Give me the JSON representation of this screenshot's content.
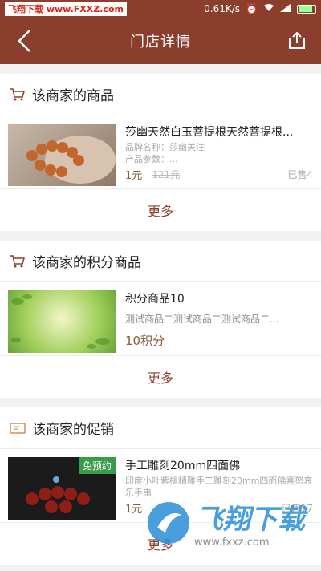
{
  "status": {
    "watermark": "飞翔下载 www.FXXZ.com",
    "speed": "0.61K/s"
  },
  "header": {
    "title": "门店详情"
  },
  "sections": {
    "goods": {
      "title": "该商家的商品",
      "item": {
        "name": "莎幽天然白玉菩提根天然菩提根...",
        "brand": "品牌名称：莎幽关注",
        "params": "产品参数：...",
        "price": "1元",
        "old_price": "121元",
        "sold": "已售4"
      },
      "more": "更多"
    },
    "points": {
      "title": "该商家的积分商品",
      "item": {
        "name": "积分商品10",
        "desc": "测试商品二测试商品二测试商品二...",
        "points": "10积分"
      },
      "more": "更多"
    },
    "promo": {
      "title": "该商家的促销",
      "item": {
        "badge": "免预约",
        "name": "手工雕刻20mm四面佛",
        "desc": "印度小叶紫檀精雕手工雕刻20mm四面佛喜怒哀乐手串",
        "price": "1元",
        "sold": "已售17"
      },
      "more": "更多"
    }
  },
  "overlay": {
    "brand": "飞翔下载",
    "url": "www.fxxz.com"
  },
  "colors": {
    "brand": "#8b3e2c",
    "price": "#8b5a3c"
  }
}
